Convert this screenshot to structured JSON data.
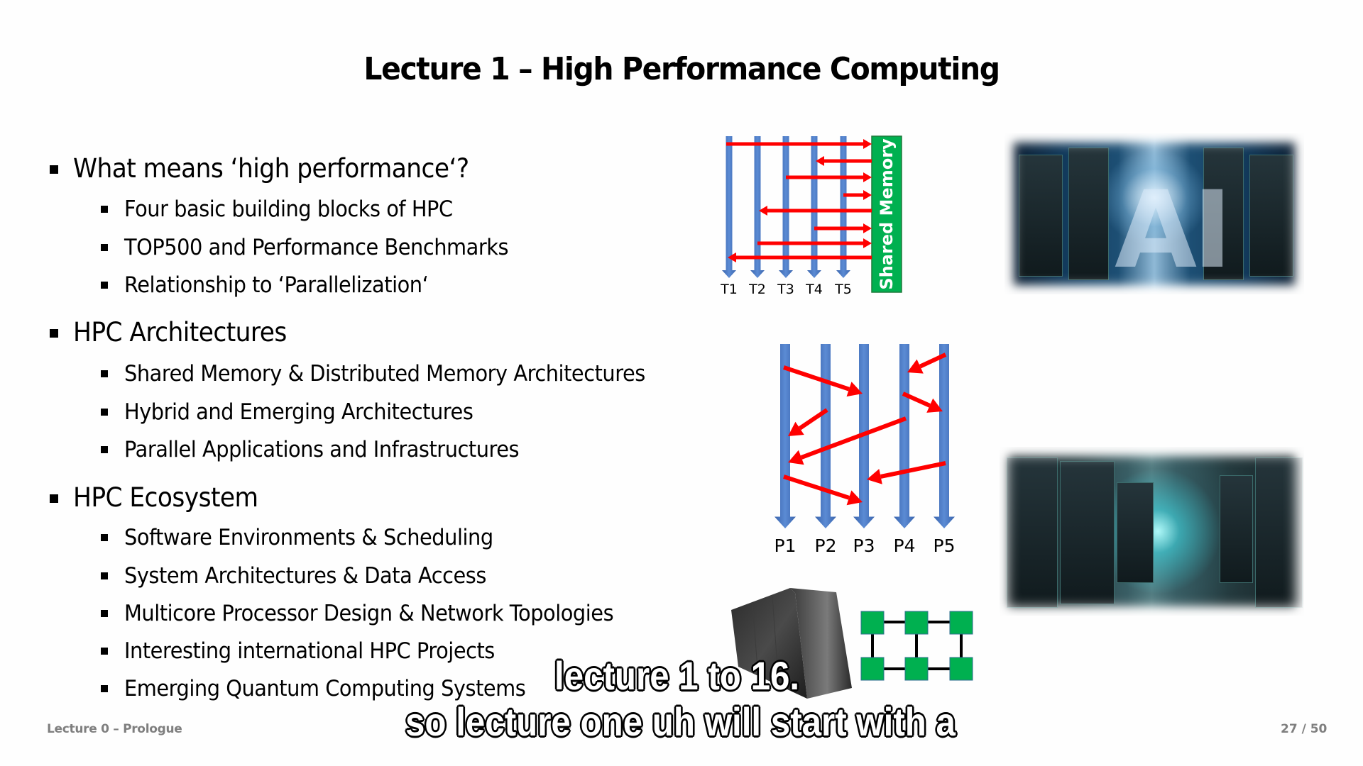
{
  "slide": {
    "title": "Lecture 1 – High Performance Computing",
    "sections": [
      {
        "label": "What means ‘high performance‘?",
        "items": [
          "Four basic building blocks of HPC",
          "TOP500 and Performance Benchmarks",
          "Relationship to ‘Parallelization‘"
        ]
      },
      {
        "label": "HPC Architectures",
        "items": [
          "Shared Memory & Distributed Memory Architectures",
          "Hybrid and Emerging Architectures",
          "Parallel Applications and Infrastructures"
        ]
      },
      {
        "label": "HPC Ecosystem",
        "items": [
          "Software Environments & Scheduling",
          "System Architectures & Data Access",
          "Multicore Processor Design & Network Topologies",
          "Interesting international HPC Projects",
          "Emerging Quantum Computing Systems"
        ]
      }
    ],
    "footer_left": "Lecture 0 – Prologue",
    "page_number": "27 / 50"
  },
  "shared_memory_diagram": {
    "memory_label": "Shared Memory",
    "threads": [
      "T1",
      "T2",
      "T3",
      "T4",
      "T5"
    ],
    "accesses": [
      {
        "thread": "T1",
        "direction": "write"
      },
      {
        "thread": "T4",
        "direction": "read"
      },
      {
        "thread": "T3",
        "direction": "write"
      },
      {
        "thread": "T5",
        "direction": "write"
      },
      {
        "thread": "T2",
        "direction": "read"
      },
      {
        "thread": "T4",
        "direction": "write"
      },
      {
        "thread": "T2",
        "direction": "write"
      },
      {
        "thread": "T1",
        "direction": "read"
      }
    ]
  },
  "distributed_memory_diagram": {
    "processes": [
      "P1",
      "P2",
      "P3",
      "P4",
      "P5"
    ],
    "messages": [
      {
        "from": "P1",
        "to": "P3"
      },
      {
        "from": "P5",
        "to": "P4"
      },
      {
        "from": "P4",
        "to": "P5"
      },
      {
        "from": "P2",
        "to": "P1"
      },
      {
        "from": "P4",
        "to": "P1"
      },
      {
        "from": "P5",
        "to": "P3"
      },
      {
        "from": "P1",
        "to": "P3"
      }
    ]
  },
  "images": {
    "ai_datacenter": "AI",
    "datacenter_corridor": "",
    "supercomputer_cabinet": "",
    "network_topology": {
      "rows": 2,
      "cols": 3
    }
  },
  "colors": {
    "thread_line": "#4472c4",
    "arrow": "#ff0000",
    "memory_box": "#00b050",
    "node": "#00b050",
    "footer": "#7f7f7f"
  },
  "captions": {
    "line1": "lecture 1 to 16.",
    "line2": "so lecture one uh will start with a"
  }
}
